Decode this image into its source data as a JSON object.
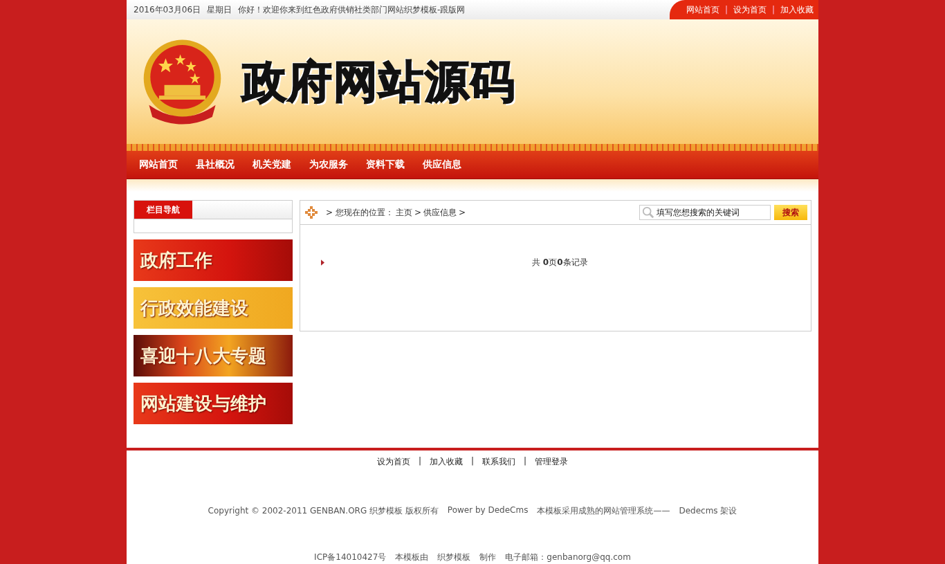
{
  "top_bar": {
    "date": "2016年03月06日",
    "weekday": "星期日",
    "greeting": "你好！欢迎你来到红色政府供销社类部门网站织梦模板-跟版网",
    "links": [
      "网站首页",
      "设为首页",
      "加入收藏"
    ],
    "separator": "|"
  },
  "header": {
    "logo_text": "政府网站源码"
  },
  "nav": [
    {
      "label": "网站首页"
    },
    {
      "label": "县社概况"
    },
    {
      "label": "机关党建"
    },
    {
      "label": "为农服务"
    },
    {
      "label": "资料下载"
    },
    {
      "label": "供应信息"
    }
  ],
  "sidebar": {
    "title": "栏目导航",
    "banners": [
      {
        "text": "政府工作",
        "kind": "red"
      },
      {
        "text": "行政效能建设",
        "kind": "gold"
      },
      {
        "text": "喜迎十八大专题",
        "kind": "dark"
      },
      {
        "text": "网站建设与维护",
        "kind": "red"
      }
    ]
  },
  "breadcrumb": {
    "text": "> 您现在的位置：",
    "links": [
      "主页",
      "供应信息"
    ],
    "separator": ">"
  },
  "search": {
    "placeholder": "填写您想搜索的关键词",
    "button": "搜索"
  },
  "list_summary": "共 **0**页**0**条记录",
  "footer": {
    "links": [
      "设为首页",
      "加入收藏",
      "联系我们",
      "管理登录"
    ],
    "separator": "|",
    "copyright": [
      "Copyright © 2002-2011 GENBAN.ORG 织梦模板 版权所有",
      "Power by DedeCms",
      "本模板采用成熟的网站管理系统——",
      "Dedecms 架设"
    ],
    "icp": [
      "ICP备14010427号",
      "本模板由",
      "织梦模板",
      "制作",
      "电子邮箱：genbanorg@qq.com"
    ]
  }
}
